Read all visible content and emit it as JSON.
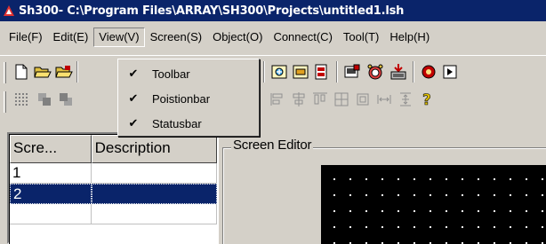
{
  "window": {
    "title": "Sh300- C:\\Program Files\\ARRAY\\SH300\\Projects\\untitled1.lsh",
    "icon": "app-logo-icon"
  },
  "menubar": {
    "items": [
      "File(F)",
      "Edit(E)",
      "View(V)",
      "Screen(S)",
      "Object(O)",
      "Connect(C)",
      "Tool(T)",
      "Help(H)"
    ],
    "open_item": "View(V)"
  },
  "view_menu": {
    "items": [
      {
        "label": "Toolbar",
        "checked": true
      },
      {
        "label": "Poistionbar",
        "checked": true
      },
      {
        "label": "Statusbar",
        "checked": true
      }
    ],
    "check_glyph": "✔"
  },
  "screen_list": {
    "columns": [
      "Scre...",
      "Description"
    ],
    "rows": [
      {
        "id": "1",
        "description": ""
      },
      {
        "id": "2",
        "description": "",
        "selected": true
      }
    ]
  },
  "editor": {
    "group_label": "Screen Editor"
  },
  "colors": {
    "titlebar": "#0a246a",
    "face": "#d4d0c8",
    "selection": "#0a246a",
    "canvas": "#000000"
  }
}
